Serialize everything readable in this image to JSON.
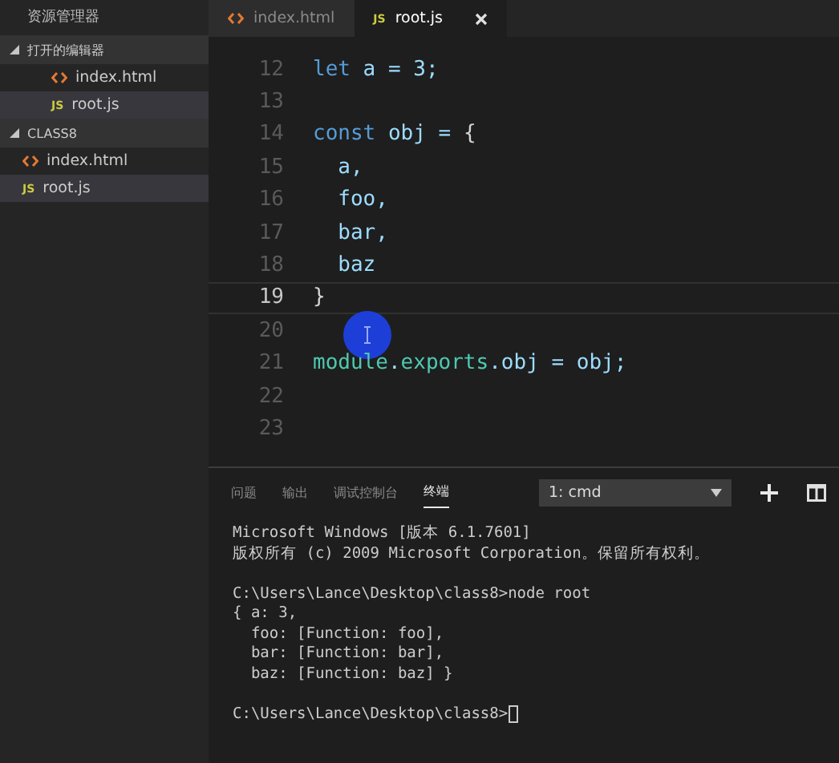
{
  "sidebar": {
    "title": "资源管理器",
    "sections": [
      {
        "label": "打开的编辑器",
        "expanded": true,
        "indented": true,
        "items": [
          {
            "name": "index.html",
            "kind": "html",
            "selected": false
          },
          {
            "name": "root.js",
            "kind": "js",
            "badge": "JS",
            "selected": true
          }
        ]
      },
      {
        "label": "CLASS8",
        "expanded": true,
        "indented": false,
        "items": [
          {
            "name": "index.html",
            "kind": "html",
            "selected": false
          },
          {
            "name": "root.js",
            "kind": "js",
            "badge": "JS",
            "selected": true
          }
        ]
      }
    ]
  },
  "tabs": [
    {
      "name": "index.html",
      "kind": "html",
      "selected": false
    },
    {
      "name": "root.js",
      "kind": "js",
      "badge": "JS",
      "selected": true
    }
  ],
  "editor": {
    "lines": [
      {
        "number": "12",
        "current": false,
        "tokens": [
          {
            "text": "let",
            "kind": "keyword"
          },
          {
            "text": " a = 3;",
            "kind": "plain"
          }
        ]
      },
      {
        "number": "13",
        "current": false
      },
      {
        "number": "14",
        "current": false,
        "tokens": [
          {
            "text": "const",
            "kind": "keyword"
          },
          {
            "text": " obj = ",
            "kind": "plain"
          },
          {
            "text": "{",
            "kind": "bracket"
          }
        ]
      },
      {
        "number": "15",
        "current": false,
        "tokens": [
          {
            "text": "  a,",
            "kind": "plain"
          }
        ]
      },
      {
        "number": "16",
        "current": false,
        "tokens": [
          {
            "text": "  foo,",
            "kind": "plain"
          }
        ]
      },
      {
        "number": "17",
        "current": false,
        "tokens": [
          {
            "text": "  bar,",
            "kind": "plain"
          }
        ]
      },
      {
        "number": "18",
        "current": false,
        "tokens": [
          {
            "text": "  baz",
            "kind": "plain"
          }
        ]
      },
      {
        "number": "19",
        "current": true,
        "tokens": [
          {
            "text": "}",
            "kind": "bracket"
          }
        ]
      },
      {
        "number": "20",
        "current": false
      },
      {
        "number": "21",
        "current": false,
        "tokens": [
          {
            "text": "module",
            "kind": "builtin"
          },
          {
            "text": ".",
            "kind": "plain"
          },
          {
            "text": "exports",
            "kind": "builtin"
          },
          {
            "text": ".obj = obj;",
            "kind": "plain"
          }
        ]
      },
      {
        "number": "22",
        "current": false
      },
      {
        "number": "23",
        "current": false
      }
    ]
  },
  "panel": {
    "tabs": [
      {
        "label": "问题",
        "selected": false
      },
      {
        "label": "输出",
        "selected": false
      },
      {
        "label": "调试控制台",
        "selected": false
      },
      {
        "label": "终端",
        "selected": true
      }
    ],
    "terminal_select": "1: cmd",
    "terminal_blocks": [
      [
        "Microsoft Windows [版本 6.1.7601]",
        "版权所有 (c) 2009 Microsoft Corporation。保留所有权利。"
      ],
      [
        "C:\\Users\\Lance\\Desktop\\class8>node root",
        "{ a: 3,",
        "  foo: [Function: foo],",
        "  bar: [Function: bar],",
        "  baz: [Function: baz] }"
      ],
      [
        "C:\\Users\\Lance\\Desktop\\class8>"
      ]
    ]
  }
}
